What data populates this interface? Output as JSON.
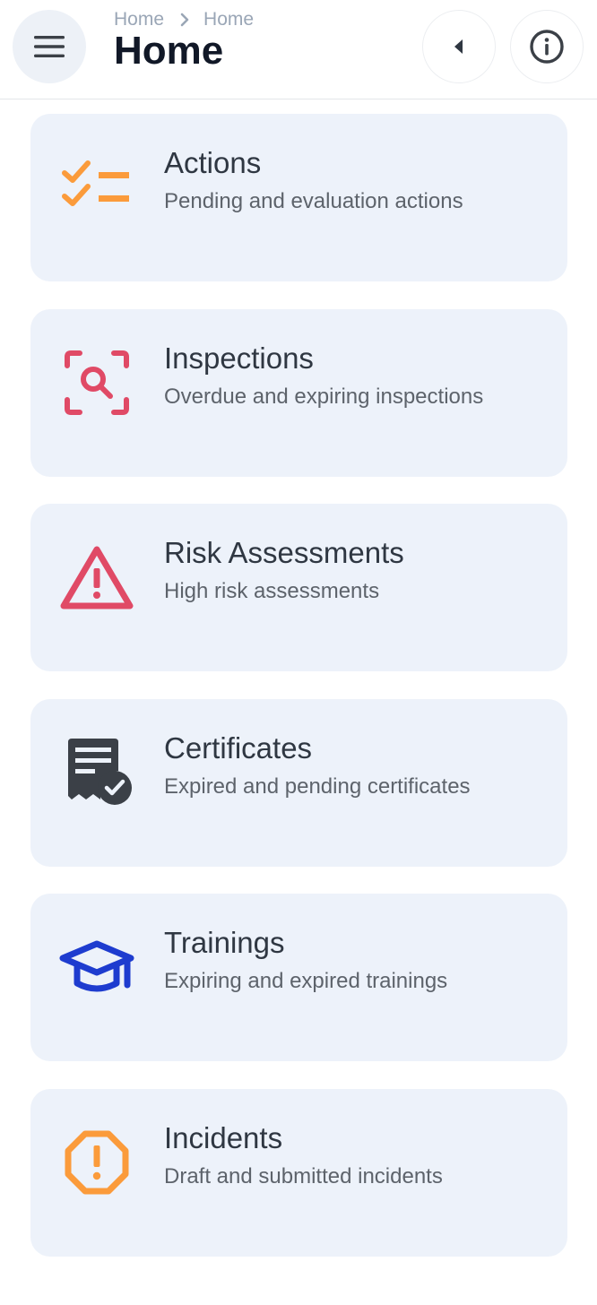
{
  "header": {
    "breadcrumb": [
      "Home",
      "Home"
    ],
    "title": "Home",
    "menu_icon": "hamburger-menu-icon",
    "back_icon": "caret-left-icon",
    "info_icon": "info-circle-icon"
  },
  "cards": [
    {
      "title": "Actions",
      "subtitle": "Pending and evaluation actions",
      "icon": "checklist-icon",
      "icon_color": "#fb9b3b"
    },
    {
      "title": "Inspections",
      "subtitle": "Overdue and expiring inspections",
      "icon": "scan-search-icon",
      "icon_color": "#e04a66"
    },
    {
      "title": "Risk Assessments",
      "subtitle": "High risk assessments",
      "icon": "warning-triangle-icon",
      "icon_color": "#e04a66"
    },
    {
      "title": "Certificates",
      "subtitle": "Expired and pending certificates",
      "icon": "certificate-check-icon",
      "icon_color": "#3b4047"
    },
    {
      "title": "Trainings",
      "subtitle": "Expiring and expired trainings",
      "icon": "graduation-cap-icon",
      "icon_color": "#1e3ccf"
    },
    {
      "title": "Incidents",
      "subtitle": "Draft and submitted incidents",
      "icon": "alert-octagon-icon",
      "icon_color": "#fb9b3b"
    }
  ]
}
